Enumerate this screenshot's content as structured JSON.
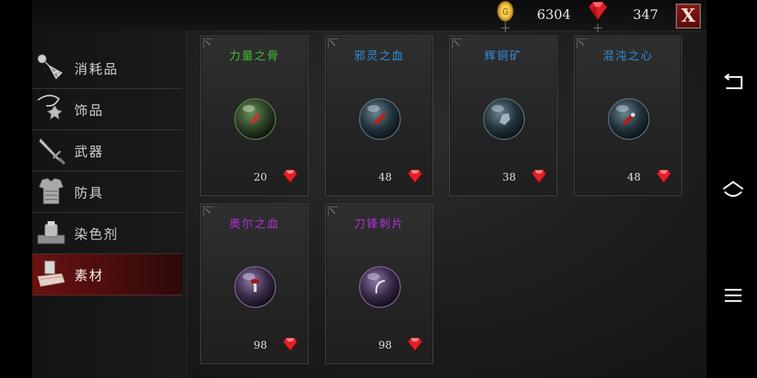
{
  "currency": {
    "gold": "6304",
    "gems": "347",
    "gold_icon": "gold-coin-icon",
    "gem_icon": "red-gem-icon"
  },
  "close_label": "X",
  "categories": [
    {
      "label": "消耗品",
      "icon": "potion-icon"
    },
    {
      "label": "饰品",
      "icon": "amulet-icon"
    },
    {
      "label": "武器",
      "icon": "sword-icon"
    },
    {
      "label": "防具",
      "icon": "armor-icon"
    },
    {
      "label": "染色剂",
      "icon": "dye-icon"
    },
    {
      "label": "素材",
      "icon": "materials-icon",
      "active": true
    }
  ],
  "items": [
    {
      "name": "力量之骨",
      "price": "20",
      "name_color": "#3fbf2f",
      "orb_color": "#3c5a2e"
    },
    {
      "name": "邪灵之血",
      "price": "48",
      "name_color": "#2f8fe0",
      "orb_color": "#2e4450"
    },
    {
      "name": "辉铜矿",
      "price": "38",
      "name_color": "#2f8fe0",
      "orb_color": "#2e4450"
    },
    {
      "name": "混沌之心",
      "price": "48",
      "name_color": "#2f8fe0",
      "orb_color": "#2e4450"
    },
    {
      "name": "奥尔之血",
      "price": "98",
      "name_color": "#b530d8",
      "orb_color": "#3e2d4d"
    },
    {
      "name": "刀锋刺片",
      "price": "98",
      "name_color": "#b530d8",
      "orb_color": "#3e2d4d"
    }
  ],
  "colors": {
    "accent_red": "#8b1515",
    "gem_red": "#e0202a"
  }
}
